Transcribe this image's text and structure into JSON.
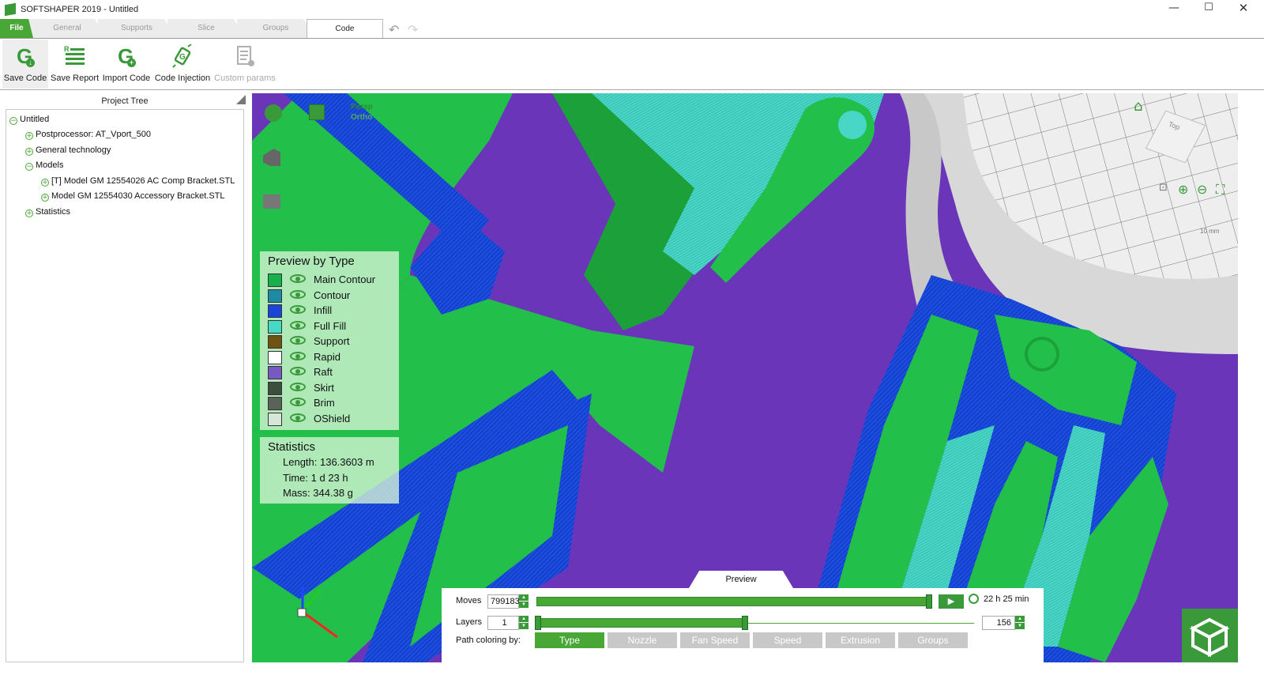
{
  "window": {
    "title": "SOFTSHAPER 2019 - Untitled",
    "controls": {
      "minimize": "—",
      "maximize": "☐",
      "close": "✕"
    }
  },
  "tabs": {
    "file": "File",
    "items": [
      {
        "label": "General"
      },
      {
        "label": "Supports"
      },
      {
        "label": "Slice"
      },
      {
        "label": "Groups"
      },
      {
        "label": "Code"
      }
    ],
    "active": "Code"
  },
  "toolbar": {
    "save_code": "Save Code",
    "save_report": "Save Report",
    "import_code": "Import Code",
    "code_injection": "Code Injection",
    "custom_params": "Custom params"
  },
  "project_tree": {
    "header": "Project Tree",
    "nodes": [
      {
        "label": "Untitled",
        "toggle": "−"
      },
      {
        "label": "Postprocessor: AT_Vport_500",
        "toggle": "+"
      },
      {
        "label": "General technology",
        "toggle": "+"
      },
      {
        "label": "Models",
        "toggle": "−"
      },
      {
        "label": "[T] Model GM 12554026 AC Comp Bracket.STL",
        "toggle": "+"
      },
      {
        "label": "Model GM 12554030 Accessory Bracket.STL",
        "toggle": "+"
      },
      {
        "label": "Statistics",
        "toggle": "+"
      }
    ]
  },
  "viewport": {
    "persp_label": "Persp",
    "ortho_label": "Ortho",
    "nav_cube_label": "Top",
    "scale_label": "10 mm",
    "colors": {
      "raft_purple": "#6a35b8",
      "main_contour_green": "#22c04a",
      "infill_blue": "#1a4de0",
      "full_fill_cyan": "#48d6c6",
      "platform_gray": "#d8d8d8"
    }
  },
  "legend": {
    "title": "Preview by Type",
    "items": [
      {
        "label": "Main Contour",
        "color": "#17b04a"
      },
      {
        "label": "Contour",
        "color": "#1f8aa6"
      },
      {
        "label": "Infill",
        "color": "#1b44d8"
      },
      {
        "label": "Full Fill",
        "color": "#46d9c5"
      },
      {
        "label": "Support",
        "color": "#6e5410"
      },
      {
        "label": "Rapid",
        "color": "#ffffff"
      },
      {
        "label": "Raft",
        "color": "#7a58c4"
      },
      {
        "label": "Skirt",
        "color": "#3e4e3e"
      },
      {
        "label": "Brim",
        "color": "#5a625a"
      },
      {
        "label": "OShield",
        "color": "#d8e6d8"
      }
    ]
  },
  "statistics": {
    "title": "Statistics",
    "length": "Length: 136.3603 m",
    "time": "Time: 1 d 23 h",
    "mass": "Mass: 344.38 g"
  },
  "preview": {
    "tab_label": "Preview",
    "moves_label": "Moves",
    "moves_value": "799183",
    "moves_time": "22 h 25 min",
    "layers_label": "Layers",
    "layers_from": "1",
    "layers_to": "156",
    "path_coloring_label": "Path coloring by:",
    "buttons": [
      "Type",
      "Nozzle",
      "Fan Speed",
      "Speed",
      "Extrusion",
      "Groups"
    ],
    "active_button": "Type"
  }
}
